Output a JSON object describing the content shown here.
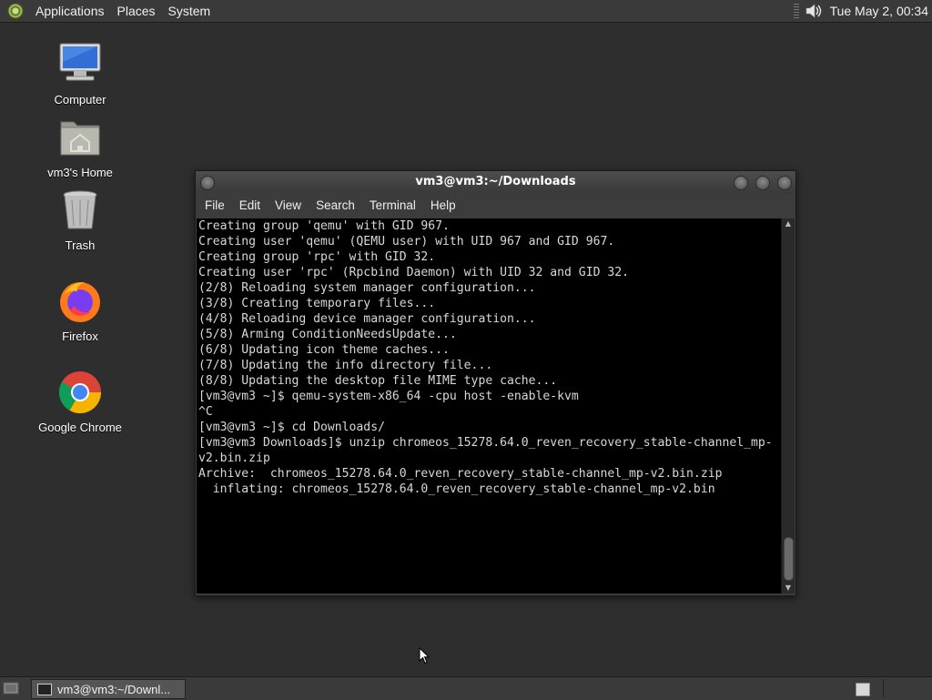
{
  "top_panel": {
    "menus": [
      "Applications",
      "Places",
      "System"
    ],
    "clock": "Tue May  2, 00:34"
  },
  "desktop_icons": {
    "computer": "Computer",
    "home": "vm3's Home",
    "trash": "Trash",
    "firefox": "Firefox",
    "chrome": "Google Chrome"
  },
  "terminal": {
    "title": "vm3@vm3:~/Downloads",
    "menu": [
      "File",
      "Edit",
      "View",
      "Search",
      "Terminal",
      "Help"
    ],
    "lines": [
      "Creating group 'qemu' with GID 967.",
      "Creating user 'qemu' (QEMU user) with UID 967 and GID 967.",
      "Creating group 'rpc' with GID 32.",
      "Creating user 'rpc' (Rpcbind Daemon) with UID 32 and GID 32.",
      "(2/8) Reloading system manager configuration...",
      "(3/8) Creating temporary files...",
      "(4/8) Reloading device manager configuration...",
      "(5/8) Arming ConditionNeedsUpdate...",
      "(6/8) Updating icon theme caches...",
      "(7/8) Updating the info directory file...",
      "(8/8) Updating the desktop file MIME type cache...",
      "[vm3@vm3 ~]$ qemu-system-x86_64 -cpu host -enable-kvm",
      "^C",
      "[vm3@vm3 ~]$ cd Downloads/",
      "[vm3@vm3 Downloads]$ unzip chromeos_15278.64.0_reven_recovery_stable-channel_mp-",
      "v2.bin.zip",
      "Archive:  chromeos_15278.64.0_reven_recovery_stable-channel_mp-v2.bin.zip",
      "  inflating: chromeos_15278.64.0_reven_recovery_stable-channel_mp-v2.bin"
    ]
  },
  "taskbar": {
    "task_label": "vm3@vm3:~/Downl..."
  },
  "colors": {
    "desktop_bg": "#2e2e2e",
    "panel_bg": "#3a3a3a",
    "terminal_bg": "#000000",
    "terminal_fg": "#d8d8d8"
  }
}
